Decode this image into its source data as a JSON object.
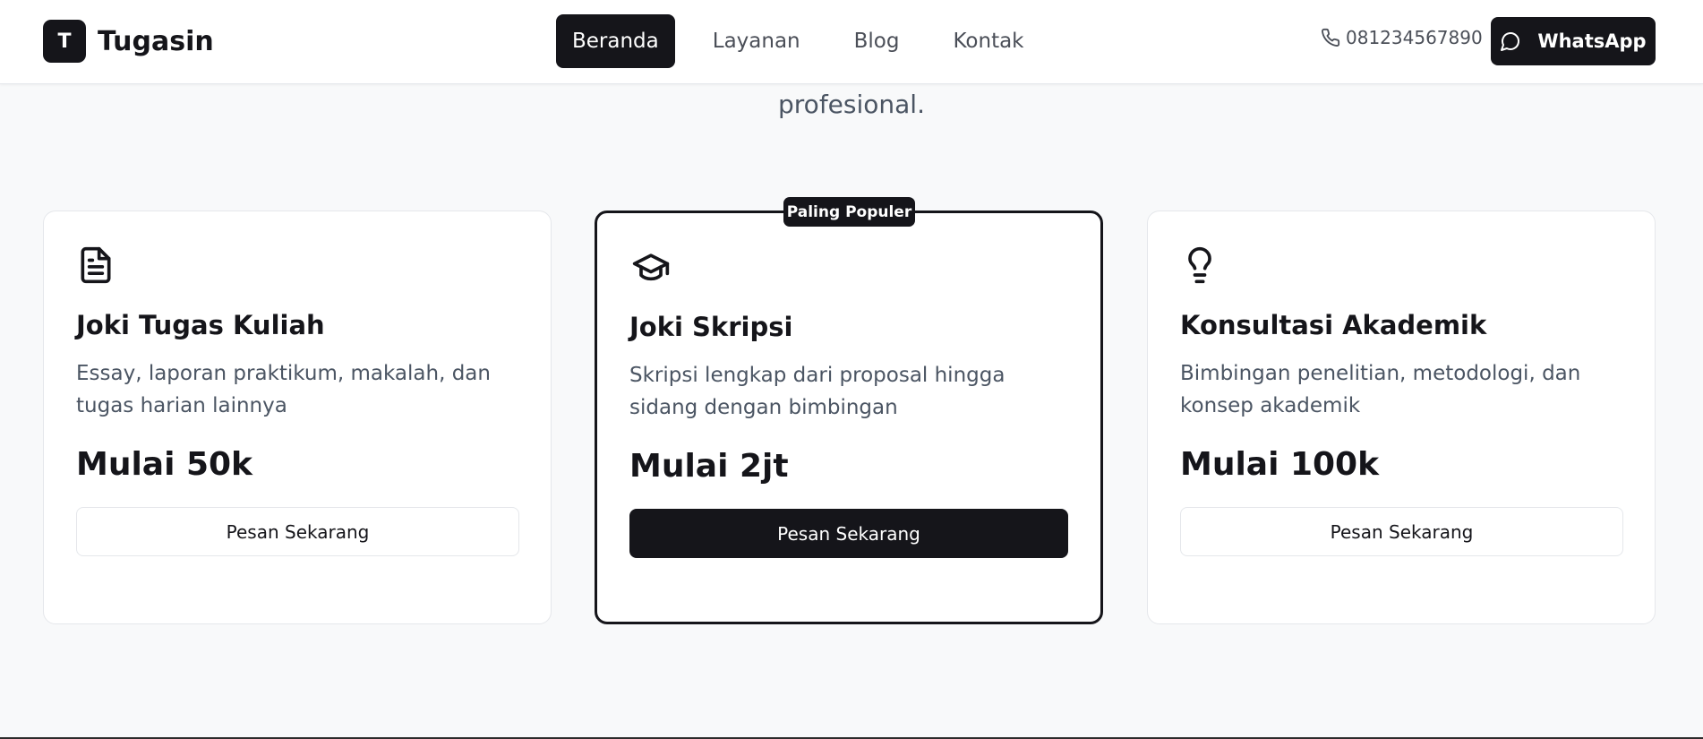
{
  "brand": {
    "initial": "T",
    "name": "Tugasin"
  },
  "nav": {
    "items": [
      {
        "label": "Beranda",
        "active": true
      },
      {
        "label": "Layanan",
        "active": false
      },
      {
        "label": "Blog",
        "active": false
      },
      {
        "label": "Kontak",
        "active": false
      }
    ]
  },
  "contact": {
    "phone": "081234567890",
    "whatsapp_label": "WhatsApp"
  },
  "intro": {
    "tail_text": "profesional."
  },
  "services": [
    {
      "icon": "document-icon",
      "title": "Joki Tugas Kuliah",
      "description": "Essay, laporan praktikum, makalah, dan tugas harian lainnya",
      "price": "Mulai 50k",
      "cta": "Pesan Sekarang"
    },
    {
      "icon": "graduation-cap-icon",
      "title": "Joki Skripsi",
      "description": "Skripsi lengkap dari proposal hingga sidang dengan bimbingan",
      "price": "Mulai 2jt",
      "cta": "Pesan Sekarang",
      "badge": "Paling Populer"
    },
    {
      "icon": "lightbulb-icon",
      "title": "Konsultasi Akademik",
      "description": "Bimbingan penelitian, metodologi, dan konsep akademik",
      "price": "Mulai 100k",
      "cta": "Pesan Sekarang"
    }
  ],
  "colors": {
    "primary": "#15151a",
    "muted_text": "#4b5563",
    "background": "#f8f9fa",
    "card_border": "#e5e7eb"
  }
}
